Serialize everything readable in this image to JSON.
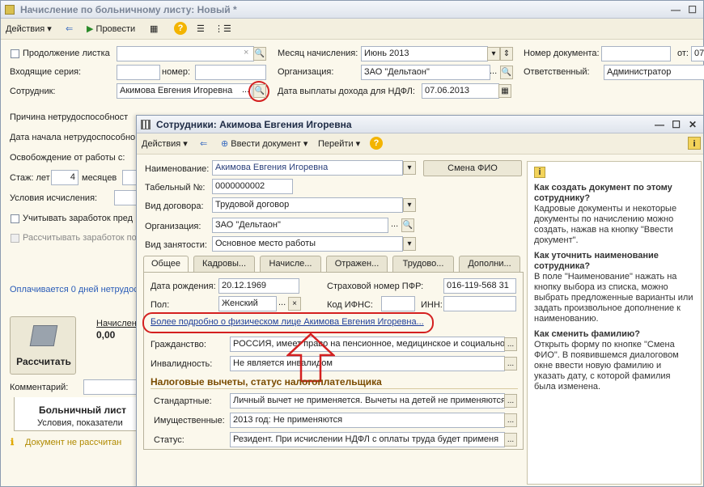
{
  "main": {
    "title": "Начисление по больничному листу: Новый *",
    "toolbar": {
      "actions": "Действия",
      "post": "Провести"
    },
    "continuation_label": "Продолжение листка",
    "incoming_series_label": "Входящие серия:",
    "number_label": "номер:",
    "employee_label": "Сотрудник:",
    "employee_value": "Акимова Евгения Игоревна",
    "month_label": "Месяц начисления:",
    "month_value": "Июнь 2013",
    "org_label": "Организация:",
    "org_value": "ЗАО \"Дельтаон\"",
    "payout_date_label": "Дата выплаты дохода для НДФЛ:",
    "payout_date_value": "07.06.2013",
    "doc_number_label": "Номер документа:",
    "from_label": "от:",
    "from_value": "07",
    "responsible_label": "Ответственный:",
    "responsible_value": "Администратор",
    "disability_reason_label": "Причина нетрудоспособност",
    "start_date_label": "Дата начала нетрудоспособно",
    "release_label": "Освобождение от работы с:",
    "experience_label": "Стаж: лет",
    "experience_years": "4",
    "months_label": "месяцев",
    "conditions_label": "Условия исчисления:",
    "consider_earnings": "Учитывать заработок пред",
    "calc_earnings": "Рассчитывать заработок по",
    "paid_days": "Оплачивается 0 дней нетрудос",
    "accrued_label": "Начислен",
    "accrued_value": "0,00",
    "calc_button": "Рассчитать",
    "comment_label": "Комментарий:",
    "sheet_title": "Больничный лист",
    "sheet_sub": "Условия, показатели",
    "not_calculated": "Документ не рассчитан"
  },
  "dialog": {
    "title": "Сотрудники: Акимова Евгения Игоревна",
    "toolbar": {
      "actions": "Действия",
      "enter_doc": "Ввести документ",
      "goto": "Перейти"
    },
    "name_label": "Наименование:",
    "name_value": "Акимова Евгения Игоревна",
    "change_name_button": "Смена ФИО",
    "tab_number_label": "Табельный №:",
    "tab_number_value": "0000000002",
    "contract_label": "Вид договора:",
    "contract_value": "Трудовой договор",
    "org_label": "Организация:",
    "org_value": "ЗАО \"Дельтаон\"",
    "employment_label": "Вид занятости:",
    "employment_value": "Основное место работы",
    "tabs": [
      "Общее",
      "Кадровы...",
      "Начисле...",
      "Отражен...",
      "Трудово...",
      "Дополни..."
    ],
    "birth_label": "Дата рождения:",
    "birth_value": "20.12.1969",
    "pfr_label": "Страховой номер ПФР:",
    "pfr_value": "016-119-568 31",
    "gender_label": "Пол:",
    "gender_value": "Женский",
    "ifns_label": "Код ИФНС:",
    "inn_label": "ИНН:",
    "more_link": "Более подробно о физическом лице Акимова Евгения Игоревна...",
    "citizenship_label": "Гражданство:",
    "citizenship_value": "РОССИЯ, имеет право на пенсионное, медицинское и социально",
    "disability_label": "Инвалидность:",
    "disability_value": "Не является инвалидом",
    "tax_section": "Налоговые вычеты, статус налогоплательщика",
    "standard_label": "Стандартные:",
    "standard_value": "Личный вычет не применяется. Вычеты на детей не применяются",
    "property_label": "Имущественные:",
    "property_value": "2013 год: Не применяются",
    "status_label": "Статус:",
    "status_value": "Резидент. При исчислении НДФЛ с оплаты труда будет применя",
    "help": {
      "q1": "Как создать документ по этому сотруднику?",
      "a1": "Кадровые документы и некоторые документы по начислению можно создать, нажав на кнопку \"Ввести документ\".",
      "q2": "Как уточнить наименование сотрудника?",
      "a2": "В поле \"Наименование\" нажать на кнопку выбора из списка, можно выбрать предложенные варианты или задать произвольное дополнение к наименованию.",
      "q3": "Как сменить фамилию?",
      "a3": "Открыть форму по кнопке \"Смена ФИО\". В появившемся диалоговом окне ввести новую фамилию и указать дату, с которой фамилия была изменена."
    }
  },
  "colors": {
    "accent_red": "#d42020",
    "link": "#1f3f9a",
    "section": "#7a4b00",
    "info_yellow": "#f3c000"
  }
}
